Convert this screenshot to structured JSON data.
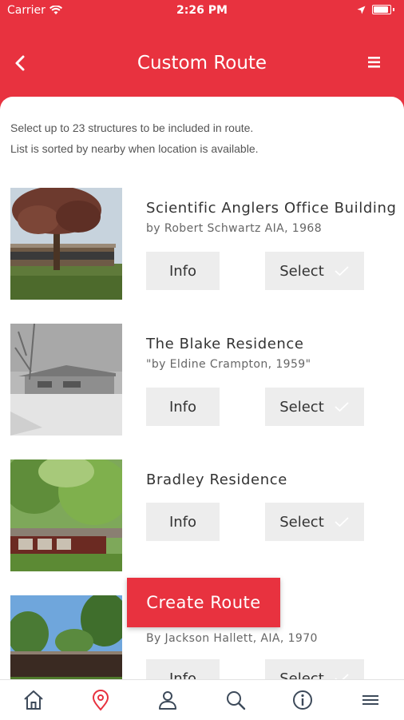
{
  "status_bar": {
    "carrier": "Carrier",
    "time": "2:26 PM"
  },
  "nav": {
    "title": "Custom Route",
    "back_icon": "chevron-left-icon",
    "menu_icon": "menu-icon"
  },
  "intro": {
    "line1": "Select up to 23 structures to be included in route.",
    "line2": "List is sorted by nearby when location is available."
  },
  "structures": [
    {
      "title": "Scientific Anglers Office Building",
      "subtitle": "by Robert Schwartz AIA, 1968",
      "info_label": "Info",
      "select_label": "Select"
    },
    {
      "title": "The Blake Residence",
      "subtitle": "\"by Eldine Crampton, 1959\"",
      "info_label": "Info",
      "select_label": "Select"
    },
    {
      "title": "Bradley Residence",
      "subtitle": "",
      "info_label": "Info",
      "select_label": "Select"
    },
    {
      "title": "",
      "subtitle": "By Jackson Hallett, AIA, 1970",
      "info_label": "Info",
      "select_label": "Select"
    }
  ],
  "create_route_label": "Create Route",
  "tabbar": {
    "items": [
      "home-icon",
      "location-pin-icon",
      "user-icon",
      "search-icon",
      "info-icon",
      "menu-icon"
    ],
    "active": "location-pin-icon"
  },
  "colors": {
    "brand_red": "#e8323f",
    "button_gray": "#ededed",
    "text_dark": "#333333",
    "tab_icon": "#3d4a5a"
  }
}
